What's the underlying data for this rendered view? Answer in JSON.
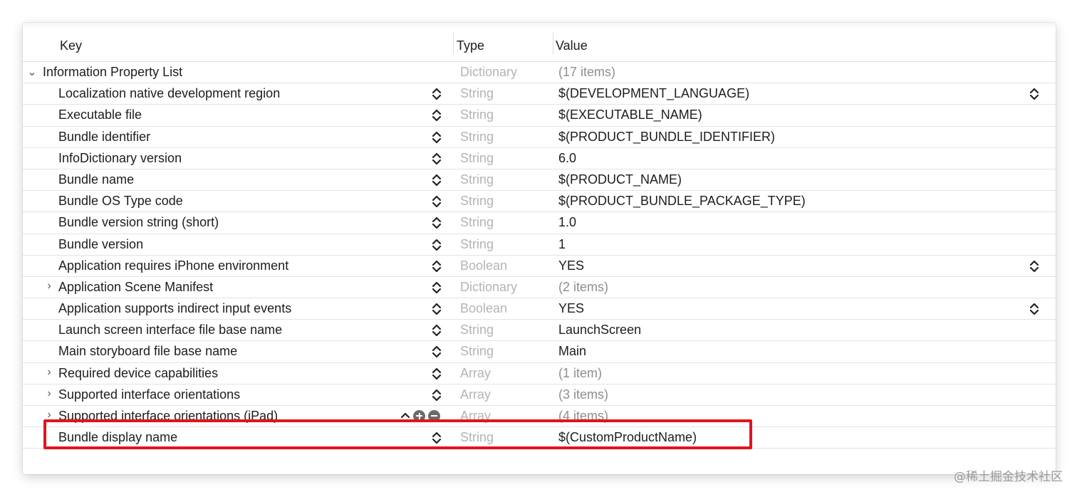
{
  "header": {
    "key_label": "Key",
    "type_label": "Type",
    "value_label": "Value"
  },
  "root": {
    "key": "Information Property List",
    "type": "Dictionary",
    "value": "(17 items)"
  },
  "rows": [
    {
      "key": "Localization native development region",
      "type": "String",
      "value": "$(DEVELOPMENT_LANGUAGE)"
    },
    {
      "key": "Executable file",
      "type": "String",
      "value": "$(EXECUTABLE_NAME)"
    },
    {
      "key": "Bundle identifier",
      "type": "String",
      "value": "$(PRODUCT_BUNDLE_IDENTIFIER)"
    },
    {
      "key": "InfoDictionary version",
      "type": "String",
      "value": "6.0"
    },
    {
      "key": "Bundle name",
      "type": "String",
      "value": "$(PRODUCT_NAME)"
    },
    {
      "key": "Bundle OS Type code",
      "type": "String",
      "value": "$(PRODUCT_BUNDLE_PACKAGE_TYPE)"
    },
    {
      "key": "Bundle version string (short)",
      "type": "String",
      "value": "1.0"
    },
    {
      "key": "Bundle version",
      "type": "String",
      "value": "1"
    },
    {
      "key": "Application requires iPhone environment",
      "type": "Boolean",
      "value": "YES"
    },
    {
      "key": "Application Scene Manifest",
      "type": "Dictionary",
      "value": "(2 items)"
    },
    {
      "key": "Application supports indirect input events",
      "type": "Boolean",
      "value": "YES"
    },
    {
      "key": "Launch screen interface file base name",
      "type": "String",
      "value": "LaunchScreen"
    },
    {
      "key": "Main storyboard file base name",
      "type": "String",
      "value": "Main"
    },
    {
      "key": "Required device capabilities",
      "type": "Array",
      "value": "(1 item)"
    },
    {
      "key": "Supported interface orientations",
      "type": "Array",
      "value": "(3 items)"
    },
    {
      "key": "Supported interface orientations (iPad)",
      "type": "Array",
      "value": "(4 items)"
    },
    {
      "key": "Bundle display name",
      "type": "String",
      "value": "$(CustomProductName)"
    }
  ],
  "watermark": "@稀土掘金技术社区",
  "colors": {
    "highlight_border": "#e3131d",
    "type_text": "#b4b4b4",
    "muted_value": "#8e8e8e"
  },
  "icons": {
    "expanded": "chevron-down-icon",
    "collapsed": "chevron-right-icon",
    "stepper": "up-down-stepper-icon",
    "add": "plus-circle-icon",
    "remove": "minus-circle-icon"
  }
}
